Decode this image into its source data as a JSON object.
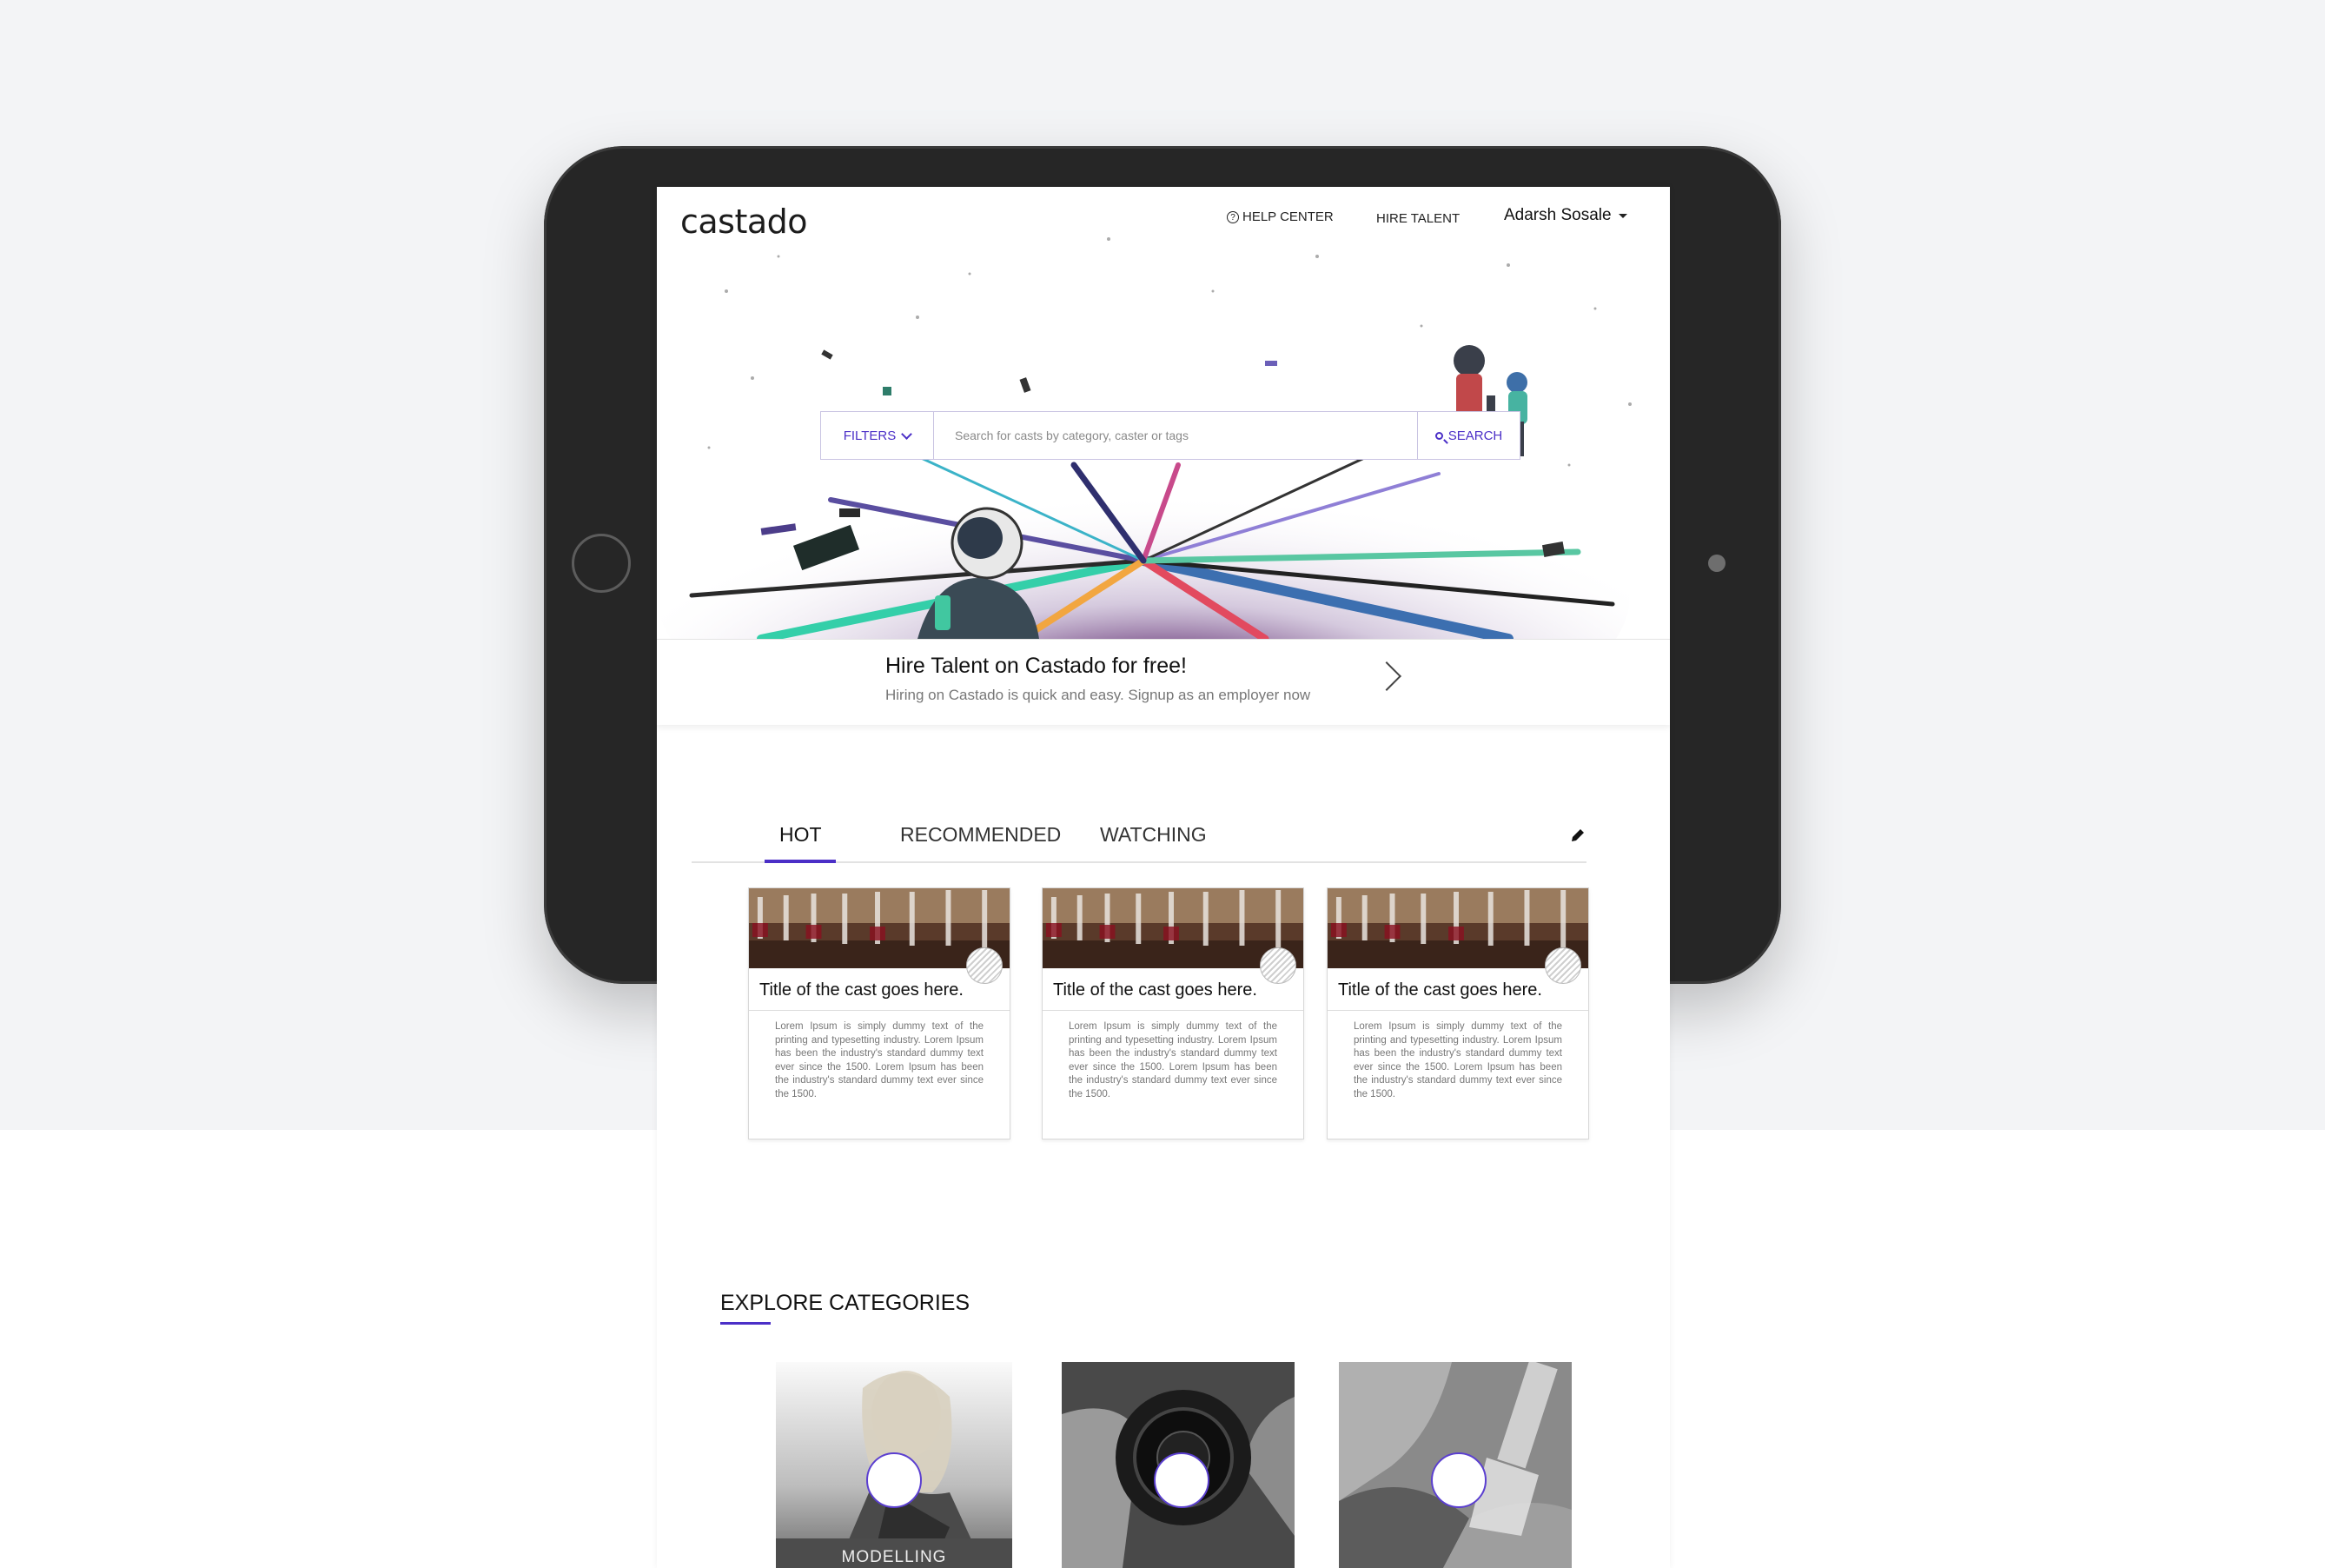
{
  "brand": {
    "logo": "castado",
    "accent": "#4b2fc7"
  },
  "nav": {
    "help_center": "HELP CENTER",
    "hire_talent": "HIRE TALENT",
    "user_name": "Adarsh Sosale"
  },
  "search": {
    "filters_label": "FILTERS",
    "placeholder": "Search for casts by category, caster or tags",
    "button_label": "SEARCH"
  },
  "promo": {
    "title": "Hire Talent on Castado for free!",
    "subtitle": "Hiring on Castado is quick and easy. Signup as an employer now"
  },
  "tabs": [
    {
      "label": "HOT",
      "active": true
    },
    {
      "label": "RECOMMENDED",
      "active": false
    },
    {
      "label": "WATCHING",
      "active": false
    }
  ],
  "cards": [
    {
      "title": "Title of the cast goes here.",
      "description": "Lorem Ipsum is simply dummy text of the printing and typesetting industry. Lorem Ipsum has been the industry's standard dummy text ever since the 1500. Lorem Ipsum has been the industry's standard dummy text ever since the 1500."
    },
    {
      "title": "Title of the cast goes here.",
      "description": "Lorem Ipsum is simply dummy text of the printing and typesetting industry. Lorem Ipsum has been the industry's standard dummy text ever since the 1500. Lorem Ipsum has been the industry's standard dummy text ever since the 1500."
    },
    {
      "title": "Title of the cast goes here.",
      "description": "Lorem Ipsum is simply dummy text of the printing and typesetting industry. Lorem Ipsum has been the industry's standard dummy text ever since the 1500. Lorem Ipsum has been the industry's standard dummy text ever since the 1500."
    }
  ],
  "explore": {
    "title": "EXPLORE CATEGORIES",
    "categories": [
      {
        "label": "MODELLING"
      },
      {
        "label": ""
      },
      {
        "label": ""
      }
    ]
  },
  "icons": [
    "help-icon",
    "caret-down-icon",
    "chevron-down-icon",
    "search-icon",
    "chevron-right-icon",
    "pencil-icon"
  ]
}
